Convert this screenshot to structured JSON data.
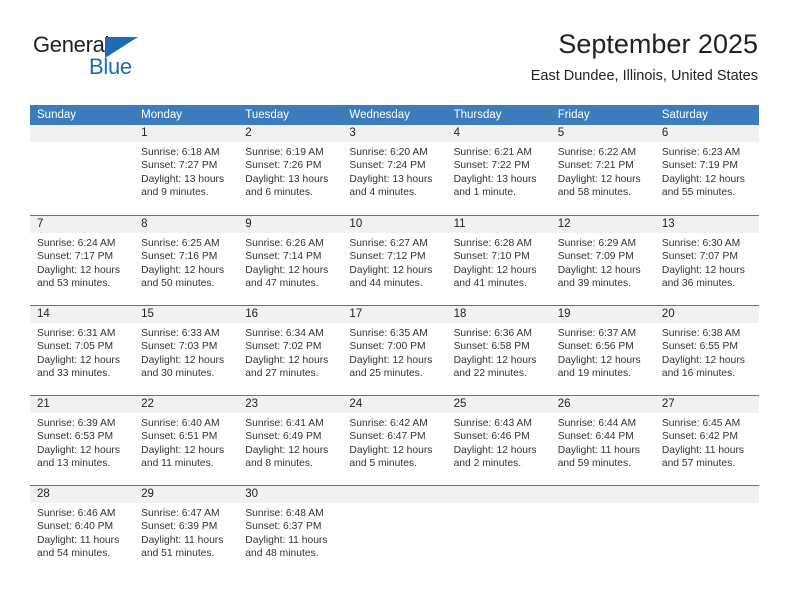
{
  "brand": {
    "name_top": "General",
    "name_bottom": "Blue",
    "color_primary": "#1f6cb4",
    "color_text": "#231f20"
  },
  "header": {
    "title": "September 2025",
    "subtitle": "East Dundee, Illinois, United States"
  },
  "theme": {
    "header_bar": "#3c7cbd",
    "day_band": "#f1f1f1",
    "separator": "#3c7cbd",
    "text": "#333333"
  },
  "weekdays": [
    "Sunday",
    "Monday",
    "Tuesday",
    "Wednesday",
    "Thursday",
    "Friday",
    "Saturday"
  ],
  "weeks": [
    [
      {
        "day": "",
        "sunrise": "",
        "sunset": "",
        "daylight1": "",
        "daylight2": ""
      },
      {
        "day": "1",
        "sunrise": "Sunrise: 6:18 AM",
        "sunset": "Sunset: 7:27 PM",
        "daylight1": "Daylight: 13 hours",
        "daylight2": "and 9 minutes."
      },
      {
        "day": "2",
        "sunrise": "Sunrise: 6:19 AM",
        "sunset": "Sunset: 7:26 PM",
        "daylight1": "Daylight: 13 hours",
        "daylight2": "and 6 minutes."
      },
      {
        "day": "3",
        "sunrise": "Sunrise: 6:20 AM",
        "sunset": "Sunset: 7:24 PM",
        "daylight1": "Daylight: 13 hours",
        "daylight2": "and 4 minutes."
      },
      {
        "day": "4",
        "sunrise": "Sunrise: 6:21 AM",
        "sunset": "Sunset: 7:22 PM",
        "daylight1": "Daylight: 13 hours",
        "daylight2": "and 1 minute."
      },
      {
        "day": "5",
        "sunrise": "Sunrise: 6:22 AM",
        "sunset": "Sunset: 7:21 PM",
        "daylight1": "Daylight: 12 hours",
        "daylight2": "and 58 minutes."
      },
      {
        "day": "6",
        "sunrise": "Sunrise: 6:23 AM",
        "sunset": "Sunset: 7:19 PM",
        "daylight1": "Daylight: 12 hours",
        "daylight2": "and 55 minutes."
      }
    ],
    [
      {
        "day": "7",
        "sunrise": "Sunrise: 6:24 AM",
        "sunset": "Sunset: 7:17 PM",
        "daylight1": "Daylight: 12 hours",
        "daylight2": "and 53 minutes."
      },
      {
        "day": "8",
        "sunrise": "Sunrise: 6:25 AM",
        "sunset": "Sunset: 7:16 PM",
        "daylight1": "Daylight: 12 hours",
        "daylight2": "and 50 minutes."
      },
      {
        "day": "9",
        "sunrise": "Sunrise: 6:26 AM",
        "sunset": "Sunset: 7:14 PM",
        "daylight1": "Daylight: 12 hours",
        "daylight2": "and 47 minutes."
      },
      {
        "day": "10",
        "sunrise": "Sunrise: 6:27 AM",
        "sunset": "Sunset: 7:12 PM",
        "daylight1": "Daylight: 12 hours",
        "daylight2": "and 44 minutes."
      },
      {
        "day": "11",
        "sunrise": "Sunrise: 6:28 AM",
        "sunset": "Sunset: 7:10 PM",
        "daylight1": "Daylight: 12 hours",
        "daylight2": "and 41 minutes."
      },
      {
        "day": "12",
        "sunrise": "Sunrise: 6:29 AM",
        "sunset": "Sunset: 7:09 PM",
        "daylight1": "Daylight: 12 hours",
        "daylight2": "and 39 minutes."
      },
      {
        "day": "13",
        "sunrise": "Sunrise: 6:30 AM",
        "sunset": "Sunset: 7:07 PM",
        "daylight1": "Daylight: 12 hours",
        "daylight2": "and 36 minutes."
      }
    ],
    [
      {
        "day": "14",
        "sunrise": "Sunrise: 6:31 AM",
        "sunset": "Sunset: 7:05 PM",
        "daylight1": "Daylight: 12 hours",
        "daylight2": "and 33 minutes."
      },
      {
        "day": "15",
        "sunrise": "Sunrise: 6:33 AM",
        "sunset": "Sunset: 7:03 PM",
        "daylight1": "Daylight: 12 hours",
        "daylight2": "and 30 minutes."
      },
      {
        "day": "16",
        "sunrise": "Sunrise: 6:34 AM",
        "sunset": "Sunset: 7:02 PM",
        "daylight1": "Daylight: 12 hours",
        "daylight2": "and 27 minutes."
      },
      {
        "day": "17",
        "sunrise": "Sunrise: 6:35 AM",
        "sunset": "Sunset: 7:00 PM",
        "daylight1": "Daylight: 12 hours",
        "daylight2": "and 25 minutes."
      },
      {
        "day": "18",
        "sunrise": "Sunrise: 6:36 AM",
        "sunset": "Sunset: 6:58 PM",
        "daylight1": "Daylight: 12 hours",
        "daylight2": "and 22 minutes."
      },
      {
        "day": "19",
        "sunrise": "Sunrise: 6:37 AM",
        "sunset": "Sunset: 6:56 PM",
        "daylight1": "Daylight: 12 hours",
        "daylight2": "and 19 minutes."
      },
      {
        "day": "20",
        "sunrise": "Sunrise: 6:38 AM",
        "sunset": "Sunset: 6:55 PM",
        "daylight1": "Daylight: 12 hours",
        "daylight2": "and 16 minutes."
      }
    ],
    [
      {
        "day": "21",
        "sunrise": "Sunrise: 6:39 AM",
        "sunset": "Sunset: 6:53 PM",
        "daylight1": "Daylight: 12 hours",
        "daylight2": "and 13 minutes."
      },
      {
        "day": "22",
        "sunrise": "Sunrise: 6:40 AM",
        "sunset": "Sunset: 6:51 PM",
        "daylight1": "Daylight: 12 hours",
        "daylight2": "and 11 minutes."
      },
      {
        "day": "23",
        "sunrise": "Sunrise: 6:41 AM",
        "sunset": "Sunset: 6:49 PM",
        "daylight1": "Daylight: 12 hours",
        "daylight2": "and 8 minutes."
      },
      {
        "day": "24",
        "sunrise": "Sunrise: 6:42 AM",
        "sunset": "Sunset: 6:47 PM",
        "daylight1": "Daylight: 12 hours",
        "daylight2": "and 5 minutes."
      },
      {
        "day": "25",
        "sunrise": "Sunrise: 6:43 AM",
        "sunset": "Sunset: 6:46 PM",
        "daylight1": "Daylight: 12 hours",
        "daylight2": "and 2 minutes."
      },
      {
        "day": "26",
        "sunrise": "Sunrise: 6:44 AM",
        "sunset": "Sunset: 6:44 PM",
        "daylight1": "Daylight: 11 hours",
        "daylight2": "and 59 minutes."
      },
      {
        "day": "27",
        "sunrise": "Sunrise: 6:45 AM",
        "sunset": "Sunset: 6:42 PM",
        "daylight1": "Daylight: 11 hours",
        "daylight2": "and 57 minutes."
      }
    ],
    [
      {
        "day": "28",
        "sunrise": "Sunrise: 6:46 AM",
        "sunset": "Sunset: 6:40 PM",
        "daylight1": "Daylight: 11 hours",
        "daylight2": "and 54 minutes."
      },
      {
        "day": "29",
        "sunrise": "Sunrise: 6:47 AM",
        "sunset": "Sunset: 6:39 PM",
        "daylight1": "Daylight: 11 hours",
        "daylight2": "and 51 minutes."
      },
      {
        "day": "30",
        "sunrise": "Sunrise: 6:48 AM",
        "sunset": "Sunset: 6:37 PM",
        "daylight1": "Daylight: 11 hours",
        "daylight2": "and 48 minutes."
      },
      {
        "day": "",
        "sunrise": "",
        "sunset": "",
        "daylight1": "",
        "daylight2": ""
      },
      {
        "day": "",
        "sunrise": "",
        "sunset": "",
        "daylight1": "",
        "daylight2": ""
      },
      {
        "day": "",
        "sunrise": "",
        "sunset": "",
        "daylight1": "",
        "daylight2": ""
      },
      {
        "day": "",
        "sunrise": "",
        "sunset": "",
        "daylight1": "",
        "daylight2": ""
      }
    ]
  ]
}
